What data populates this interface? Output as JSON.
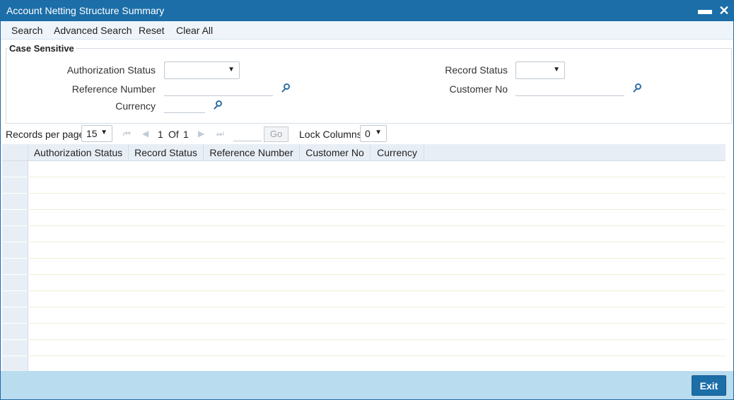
{
  "window": {
    "title": "Account Netting Structure Summary",
    "minimize_glyph": "▬",
    "close_glyph": "✕"
  },
  "toolbar": {
    "search": "Search",
    "advanced_search": "Advanced Search",
    "reset": "Reset",
    "clear_all": "Clear All"
  },
  "criteria": {
    "legend": "Case Sensitive",
    "authorization_status_label": "Authorization Status",
    "authorization_status_value": "",
    "reference_number_label": "Reference Number",
    "reference_number_value": "",
    "currency_label": "Currency",
    "currency_value": "",
    "record_status_label": "Record Status",
    "record_status_value": "",
    "customer_no_label": "Customer No",
    "customer_no_value": ""
  },
  "pager": {
    "records_per_page_label": "Records per page",
    "records_per_page_value": "15",
    "current_page": "1",
    "of_label": "Of",
    "total_pages": "1",
    "go_label": "Go",
    "lock_columns_label": "Lock Columns",
    "lock_columns_value": "0"
  },
  "grid": {
    "columns": [
      "Authorization Status",
      "Record Status",
      "Reference Number",
      "Customer No",
      "Currency"
    ],
    "row_count": 13
  },
  "footer": {
    "exit": "Exit"
  },
  "colors": {
    "titlebar": "#1c6ea8",
    "footer": "#b9dcef",
    "grid_header": "#e8eef5"
  }
}
